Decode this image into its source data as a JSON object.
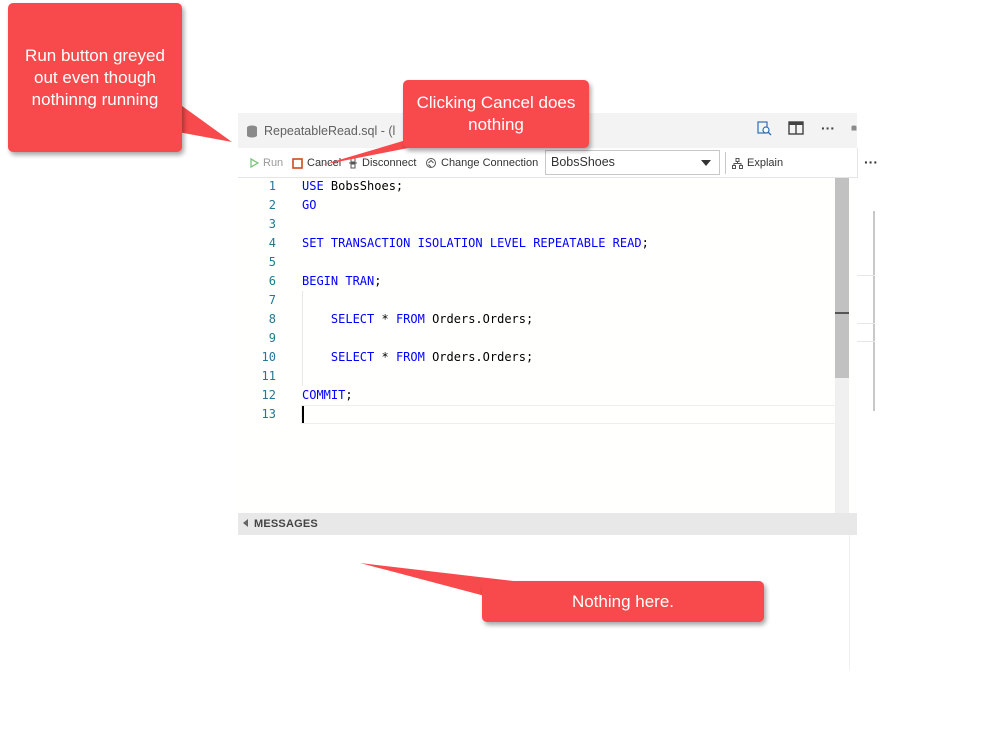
{
  "tab": {
    "filename": "RepeatableRead.sql - (l"
  },
  "toolbar": {
    "run_label": "Run",
    "cancel_label": "Cancel",
    "disconnect_label": "Disconnect",
    "change_connection_label": "Change Connection",
    "database_selected": "BobsShoes",
    "explain_label": "Explain"
  },
  "editor": {
    "line_numbers": [
      "1",
      "2",
      "3",
      "4",
      "5",
      "6",
      "7",
      "8",
      "9",
      "10",
      "11",
      "12",
      "13"
    ]
  },
  "messages": {
    "header": "MESSAGES"
  },
  "annotations": {
    "run": "Run button greyed out even though nothinng running",
    "cancel": "Clicking Cancel does nothing",
    "messages": "Nothing here."
  },
  "colors": {
    "callout": "#f84a4d",
    "keyword": "#0000ff",
    "line_number": "#237893",
    "cancel_icon": "#d0491b",
    "run_disabled": "#9a9a9a"
  },
  "icons": [
    "database-icon",
    "run-icon",
    "stop-icon",
    "disconnect-icon",
    "change-connection-icon",
    "explain-icon",
    "open-changes-icon",
    "split-editor-icon",
    "more-actions-icon",
    "collapse-arrow-icon"
  ]
}
